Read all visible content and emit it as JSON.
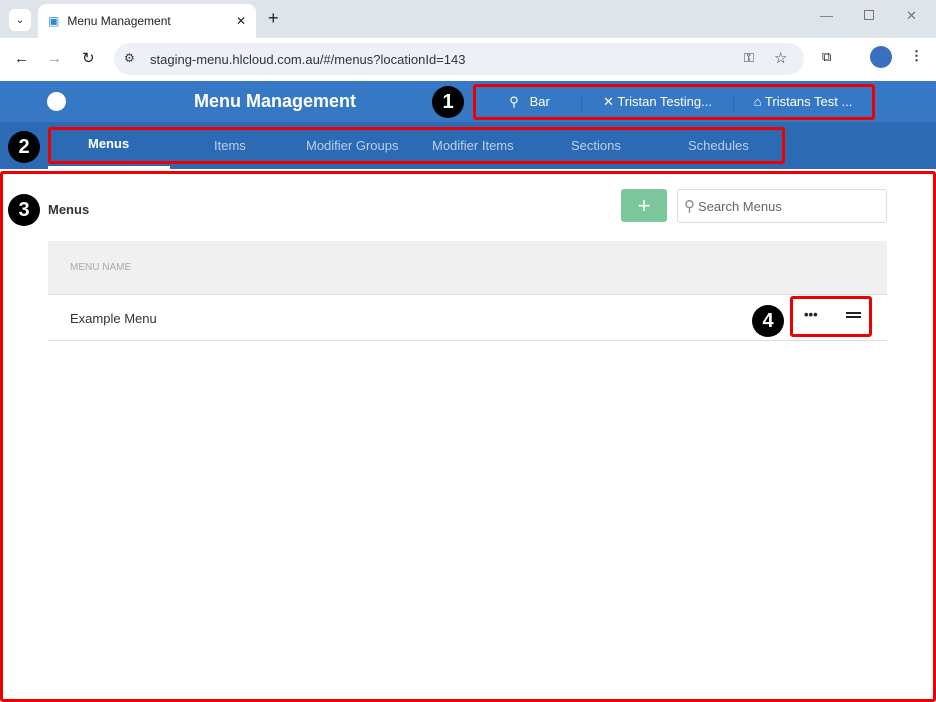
{
  "browser": {
    "tab_title": "Menu Management",
    "url": "staging-menu.hlcloud.com.au/#/menus?locationId=143"
  },
  "header": {
    "title": "Menu Management",
    "location": "Bar",
    "venue": "Tristan Testing...",
    "organisation": "Tristans Test ..."
  },
  "nav": {
    "tabs": [
      "Menus",
      "Items",
      "Modifier Groups",
      "Modifier Items",
      "Sections",
      "Schedules"
    ],
    "active": "Menus"
  },
  "content": {
    "title": "Menus",
    "add_label": "+",
    "search_placeholder": "Search Menus",
    "column_header": "MENU NAME",
    "rows": [
      {
        "name": "Example Menu"
      }
    ]
  },
  "annotations": [
    "1",
    "2",
    "3",
    "4"
  ],
  "colors": {
    "header": "#3778c4",
    "nav": "#2c6bb4",
    "add": "#7bc79b",
    "annotation": "#e00000"
  }
}
